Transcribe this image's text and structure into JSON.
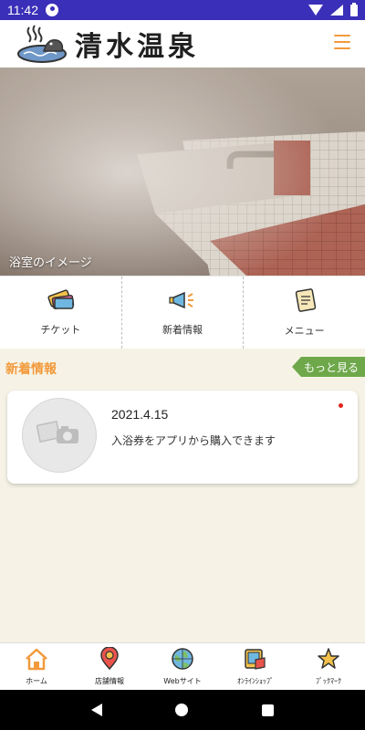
{
  "status_bar": {
    "time": "11:42"
  },
  "header": {
    "title": "清水温泉",
    "logo_icon": "onsen-logo",
    "menu_icon": "hamburger-menu-icon"
  },
  "hero": {
    "caption": "浴室のイメージ"
  },
  "quick_menu": [
    {
      "label": "チケット",
      "icon": "ticket-icon"
    },
    {
      "label": "新着情報",
      "icon": "megaphone-icon"
    },
    {
      "label": "メニュー",
      "icon": "menu-note-icon"
    }
  ],
  "news": {
    "section_title": "新着情報",
    "more_label": "もっと見る",
    "items": [
      {
        "date": "2021.4.15",
        "text": "入浴券をアプリから購入できます",
        "thumb_icon": "photo-placeholder-icon"
      }
    ]
  },
  "tabs": [
    {
      "label": "ホーム",
      "icon": "home-icon"
    },
    {
      "label": "店舗情報",
      "icon": "map-pin-icon"
    },
    {
      "label": "Webサイト",
      "icon": "globe-icon"
    },
    {
      "label": "ｵﾝﾗｲﾝｼｮｯﾌﾟ",
      "icon": "online-shop-icon"
    },
    {
      "label": "ﾌﾞｯｸﾏｰｸ",
      "icon": "bookmark-star-icon"
    }
  ],
  "colors": {
    "status_bar": "#3a2fb8",
    "accent_orange": "#f29a3c",
    "more_green": "#6ea84a",
    "content_bg": "#f6f3e6",
    "unread_red": "#e0241b"
  }
}
